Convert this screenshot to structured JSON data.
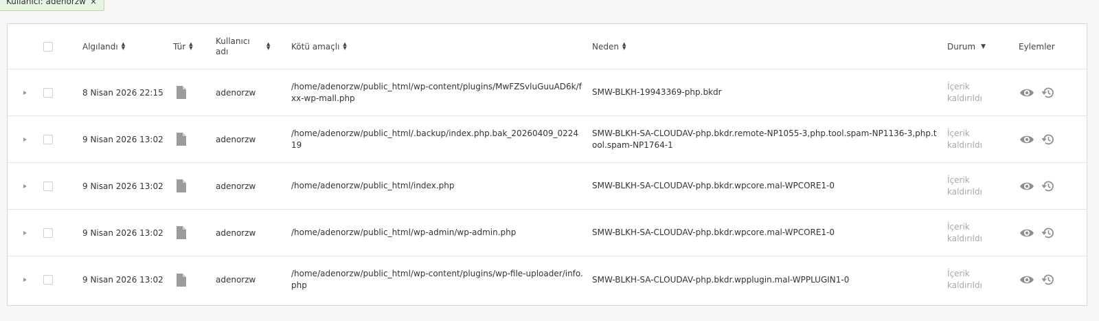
{
  "filter": {
    "label": "Kullanıcı: adenorzw",
    "remove": "×"
  },
  "columns": {
    "detected": "Algılandı",
    "type": "Tür",
    "username": "Kullanıcı adı",
    "malicious": "Kötü amaçlı",
    "reason": "Neden",
    "status": "Durum",
    "actions": "Eylemler"
  },
  "rows": [
    {
      "detected": "8 Nisan 2026 22:15",
      "type_icon": "file-icon",
      "username": "adenorzw",
      "path": "/home/adenorzw/public_html/wp-content/plugins/MwFZSvluGuuAD6k/fxx-wp-mall.php",
      "reason": "SMW-BLKH-19943369-php.bkdr",
      "status": "İçerik kaldırıldı"
    },
    {
      "detected": "9 Nisan 2026 13:02",
      "type_icon": "file-icon",
      "username": "adenorzw",
      "path": "/home/adenorzw/public_html/.backup/index.php.bak_20260409_022419",
      "reason": "SMW-BLKH-SA-CLOUDAV-php.bkdr.remote-NP1055-3,php.tool.spam-NP1136-3,php.tool.spam-NP1764-1",
      "status": "İçerik kaldırıldı"
    },
    {
      "detected": "9 Nisan 2026 13:02",
      "type_icon": "file-icon",
      "username": "adenorzw",
      "path": "/home/adenorzw/public_html/index.php",
      "reason": "SMW-BLKH-SA-CLOUDAV-php.bkdr.wpcore.mal-WPCORE1-0",
      "status": "İçerik kaldırıldı"
    },
    {
      "detected": "9 Nisan 2026 13:02",
      "type_icon": "file-icon",
      "username": "adenorzw",
      "path": "/home/adenorzw/public_html/wp-admin/wp-admin.php",
      "reason": "SMW-BLKH-SA-CLOUDAV-php.bkdr.wpcore.mal-WPCORE1-0",
      "status": "İçerik kaldırıldı"
    },
    {
      "detected": "9 Nisan 2026 13:02",
      "type_icon": "file-icon",
      "username": "adenorzw",
      "path": "/home/adenorzw/public_html/wp-content/plugins/wp-file-uploader/info.php",
      "reason": "SMW-BLKH-SA-CLOUDAV-php.bkdr.wpplugin.mal-WPPLUGIN1-0",
      "status": "İçerik kaldırıldı"
    }
  ],
  "icons": {
    "view": "eye-icon",
    "restore": "history-icon",
    "file": "file-icon"
  },
  "colors": {
    "status_text": "#a8a8a8",
    "icon_gray": "#8f8f8f",
    "filter_bg": "#e9f3e3"
  }
}
